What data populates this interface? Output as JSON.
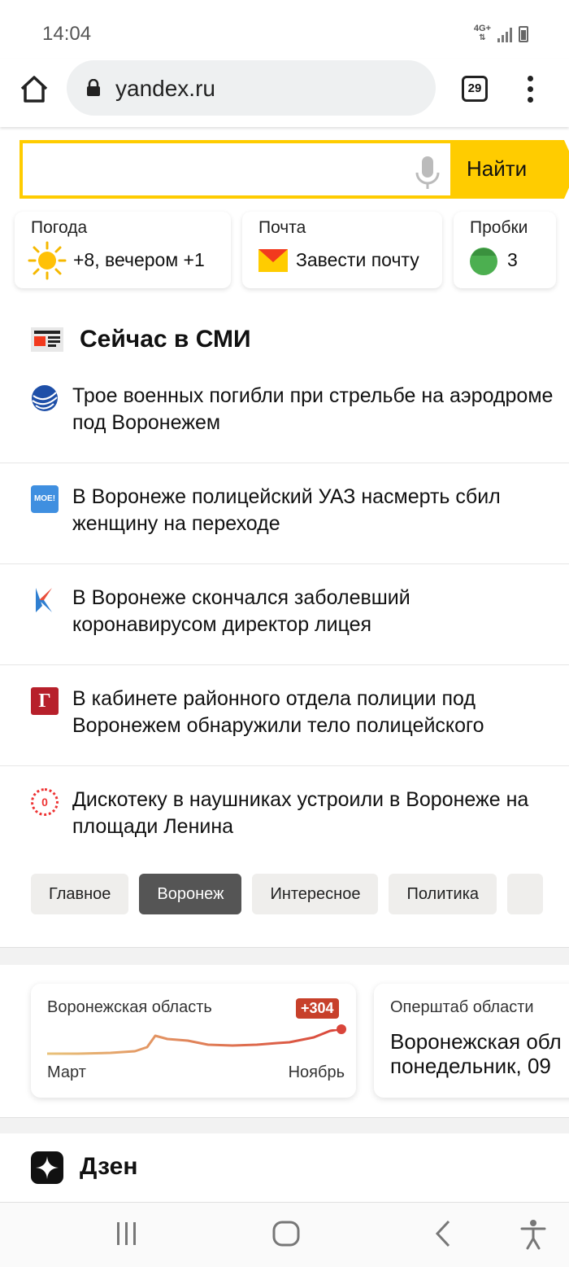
{
  "status_bar": {
    "time": "14:04",
    "network": "4G+"
  },
  "browser": {
    "url": "yandex.ru",
    "tab_count": "29"
  },
  "search": {
    "button_label": "Найти",
    "value": ""
  },
  "info_cards": {
    "weather": {
      "title": "Погода",
      "value": "+8, вечером +1",
      "icon": "sun-icon"
    },
    "mail": {
      "title": "Почта",
      "value": "Завести почту",
      "icon": "mail-envelope-icon"
    },
    "traffic": {
      "title": "Пробки",
      "value": "3",
      "icon": "traffic-light-icon",
      "color": "#4caf50"
    }
  },
  "news": {
    "title": "Сейчас в СМИ",
    "items": [
      {
        "text": "Трое военных погибли при стрельбе на аэродроме под Воронежем",
        "source_icon": "globe-source-icon"
      },
      {
        "text": "В Воронеже полицейский УАЗ насмерть сбил женщину на переходе",
        "source_icon": "moe-source-icon",
        "source_text": "MOE!"
      },
      {
        "text": "В Воронеже скончался заболевший коронавирусом директор лицея",
        "source_icon": "k-source-icon"
      },
      {
        "text": "В кабинете районного отдела полиции под Воронежем обнаружили тело полицейского",
        "source_icon": "g-source-icon",
        "source_text": "Г"
      },
      {
        "text": "Дискотеку в наушниках устроили в Воронеже на площади Ленина",
        "source_icon": "o-source-icon",
        "source_text": "0"
      }
    ],
    "tabs": [
      "Главное",
      "Воронеж",
      "Интересное",
      "Политика"
    ],
    "active_tab": "Воронеж"
  },
  "covid": {
    "region_card": {
      "title": "Воронежская область",
      "badge": "+304",
      "axis_start": "Март",
      "axis_end": "Ноябрь"
    },
    "hq_card": {
      "title": "Оперштаб области",
      "line1": "Воронежская обл",
      "line2": "понедельник, 09"
    }
  },
  "zen": {
    "title": "Дзен"
  },
  "colors": {
    "yandex_yellow": "#ffcc00",
    "badge_red": "#c7402a",
    "active_pill": "#555555"
  }
}
